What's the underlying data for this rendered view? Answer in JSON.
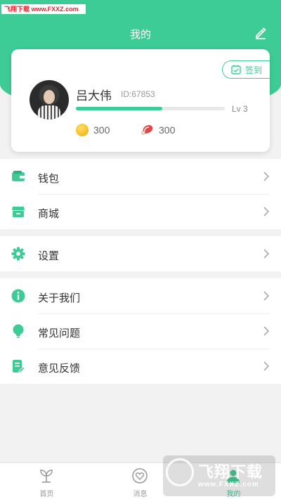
{
  "watermark_top": "飞翔下载 www.FXXZ.com",
  "header": {
    "title": "我的",
    "edit_icon": "edit-icon"
  },
  "profile": {
    "name": "吕大伟",
    "id": "ID:67853",
    "level": "Lv 3",
    "progress": 0.58,
    "coins": "300",
    "meat": "300",
    "checkin_label": "签到"
  },
  "menu_groups": [
    [
      {
        "label": "钱包",
        "icon": "wallet-icon"
      },
      {
        "label": "商城",
        "icon": "store-icon"
      }
    ],
    [
      {
        "label": "设置",
        "icon": "gear-icon"
      }
    ],
    [
      {
        "label": "关于我们",
        "icon": "info-icon"
      },
      {
        "label": "常见问题",
        "icon": "lightbulb-icon"
      },
      {
        "label": "意见反馈",
        "icon": "feedback-icon"
      }
    ]
  ],
  "tabs": [
    {
      "label": "首页",
      "icon": "sprout-icon"
    },
    {
      "label": "消息",
      "icon": "heart-icon"
    },
    {
      "label": "我的",
      "icon": "profile-icon"
    }
  ],
  "watermark_br": {
    "text": "飞翔下载",
    "url": "www.FXXZ.com"
  },
  "colors": {
    "accent": "#3dcc95",
    "background": "#f2f2f2"
  }
}
